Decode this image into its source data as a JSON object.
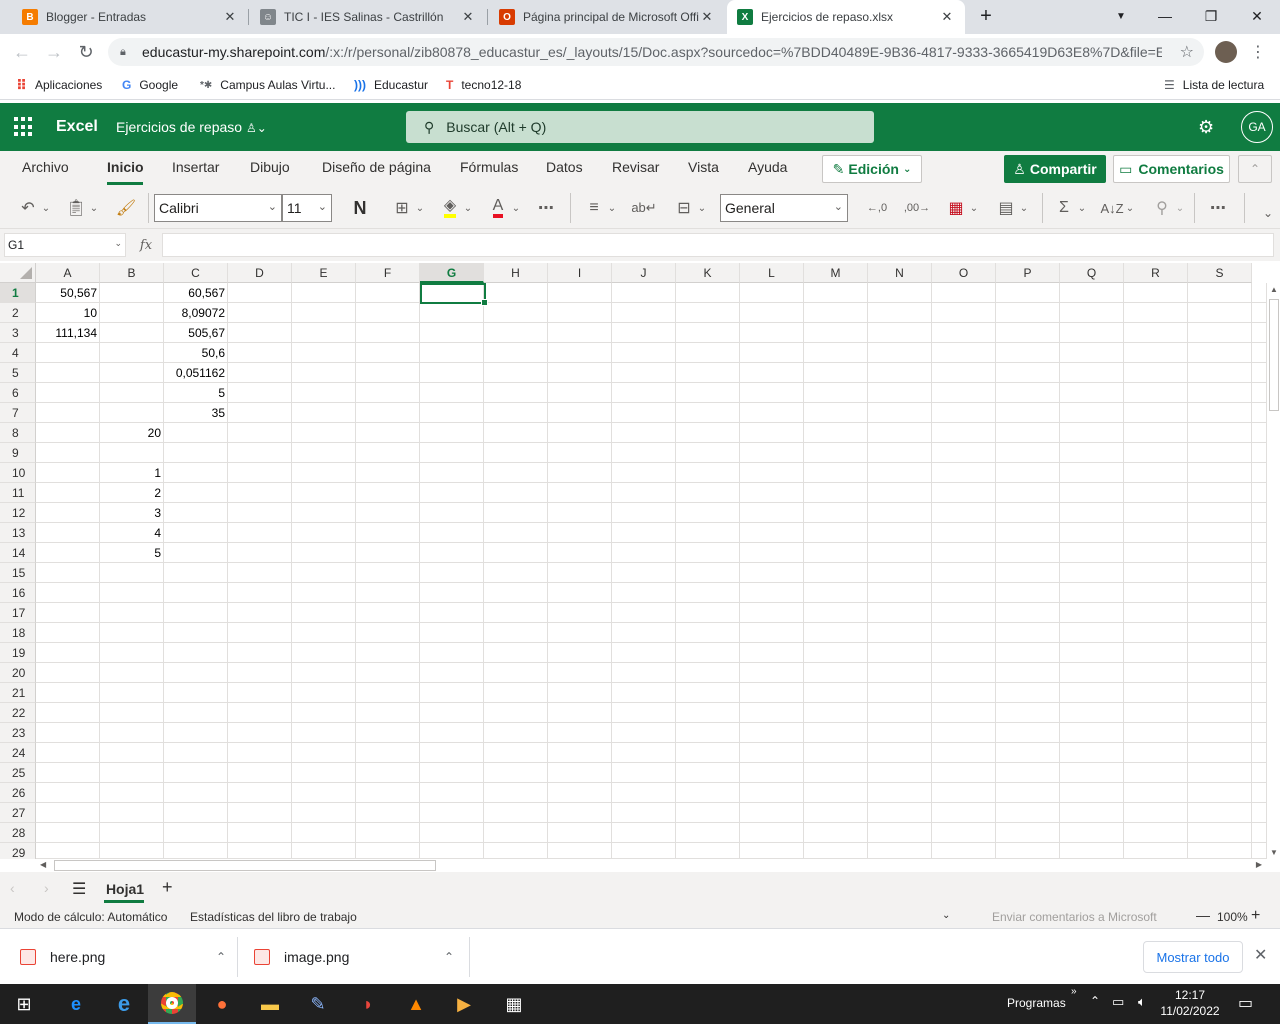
{
  "browser": {
    "tabs": [
      {
        "title": "Blogger - Entradas",
        "icon": "blogger-icon",
        "color": "#f57c00"
      },
      {
        "title": "TIC I - IES Salinas - Castrillón",
        "icon": "avatar-icon",
        "color": "#5f6368"
      },
      {
        "title": "Página principal de Microsoft Office",
        "icon": "office-icon",
        "color": "#d83b01"
      },
      {
        "title": "Ejercicios de repaso.xlsx",
        "icon": "excel-icon",
        "color": "#107c41"
      }
    ],
    "url_host": "educastur-my.sharepoint.com",
    "url_path": "/:x:/r/personal/zib80878_educastur_es/_layouts/15/Doc.aspx?sourcedoc=%7BDD40489E-9B36-4817-9333-3665419D63E8%7D&file=Ej...",
    "bookmarks": [
      "Aplicaciones",
      "Google",
      "Campus Aulas Virtu...",
      "Educastur",
      "tecno12-18"
    ],
    "reading_list": "Lista de lectura"
  },
  "excel": {
    "app_name": "Excel",
    "doc_name": "Ejercicios de repaso",
    "search_placeholder": "Buscar (Alt + Q)",
    "avatar": "GA",
    "ribbon_tabs": [
      "Archivo",
      "Inicio",
      "Insertar",
      "Dibujo",
      "Diseño de página",
      "Fórmulas",
      "Datos",
      "Revisar",
      "Vista",
      "Ayuda"
    ],
    "active_tab": "Inicio",
    "edit_mode": "Edición",
    "share": "Compartir",
    "comments": "Comentarios",
    "font_name": "Calibri",
    "font_size": "11",
    "bold_label": "N",
    "number_format": "General",
    "name_box": "G1",
    "fx": "fx",
    "columns": [
      "A",
      "B",
      "C",
      "D",
      "E",
      "F",
      "G",
      "H",
      "I",
      "J",
      "K",
      "L",
      "M",
      "N",
      "O",
      "P",
      "Q",
      "R",
      "S"
    ],
    "selected_column": "G",
    "selected_row": "1",
    "rows": [
      "1",
      "2",
      "3",
      "4",
      "5",
      "6",
      "7",
      "8",
      "9",
      "10",
      "11",
      "12",
      "13",
      "14",
      "15",
      "16",
      "17",
      "18",
      "19",
      "20",
      "21",
      "22",
      "23",
      "24",
      "25",
      "26",
      "27",
      "28",
      "29"
    ],
    "cells": [
      {
        "col": "A",
        "row": 1,
        "value": "50,567"
      },
      {
        "col": "C",
        "row": 1,
        "value": "60,567"
      },
      {
        "col": "A",
        "row": 2,
        "value": "10"
      },
      {
        "col": "C",
        "row": 2,
        "value": "8,09072"
      },
      {
        "col": "A",
        "row": 3,
        "value": "111,134"
      },
      {
        "col": "C",
        "row": 3,
        "value": "505,67"
      },
      {
        "col": "C",
        "row": 4,
        "value": "50,6"
      },
      {
        "col": "C",
        "row": 5,
        "value": "0,051162"
      },
      {
        "col": "C",
        "row": 6,
        "value": "5"
      },
      {
        "col": "C",
        "row": 7,
        "value": "35"
      },
      {
        "col": "B",
        "row": 8,
        "value": "20"
      },
      {
        "col": "B",
        "row": 10,
        "value": "1"
      },
      {
        "col": "B",
        "row": 11,
        "value": "2"
      },
      {
        "col": "B",
        "row": 12,
        "value": "3"
      },
      {
        "col": "B",
        "row": 13,
        "value": "4"
      },
      {
        "col": "B",
        "row": 14,
        "value": "5"
      }
    ],
    "sheet_name": "Hoja1",
    "status": {
      "calc_mode": "Modo de cálculo: Automático",
      "stats": "Estadísticas del libro de trabajo",
      "feedback": "Enviar comentarios a Microsoft",
      "zoom": "100%"
    },
    "accent": "#107c41"
  },
  "downloads": {
    "items": [
      "here.png",
      "image.png"
    ],
    "show_all": "Mostrar todo"
  },
  "taskbar": {
    "programs": "Programas",
    "time": "12:17",
    "date": "11/02/2022"
  }
}
